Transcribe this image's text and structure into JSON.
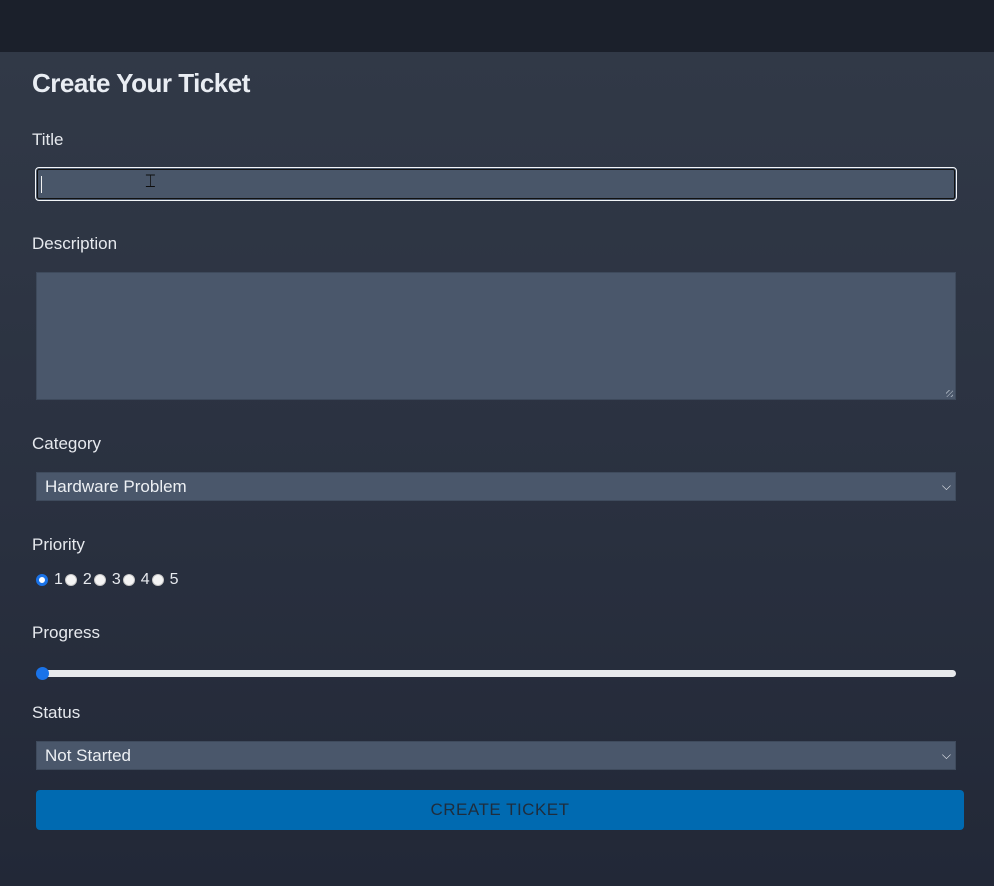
{
  "form": {
    "heading": "Create Your Ticket",
    "title": {
      "label": "Title",
      "value": "",
      "placeholder": ""
    },
    "description": {
      "label": "Description",
      "value": ""
    },
    "category": {
      "label": "Category",
      "selected": "Hardware Problem"
    },
    "priority": {
      "label": "Priority",
      "options": [
        "1",
        "2",
        "3",
        "4",
        "5"
      ],
      "selected": "1"
    },
    "progress": {
      "label": "Progress",
      "value": 0,
      "min": 0,
      "max": 100
    },
    "status": {
      "label": "Status",
      "selected": "Not Started"
    },
    "submit_label": "CREATE TICKET"
  },
  "icons": {
    "select_arrow": "chevron-down-icon",
    "cursor": "text-cursor-icon"
  },
  "colors": {
    "accent": "#1a73e8",
    "button": "#006ab1",
    "field": "#4a576b",
    "background": "#2c3342",
    "topbar": "#1b202b"
  }
}
